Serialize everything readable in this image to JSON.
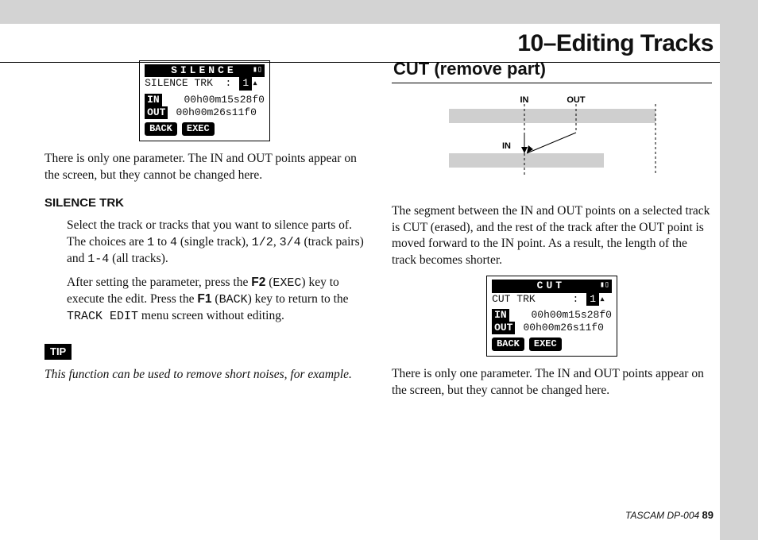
{
  "chapter_title": "10–Editing Tracks",
  "left": {
    "lcd": {
      "title": "SILENCE",
      "row_label": "SILENCE TRK",
      "row_value": "1",
      "in_label": "IN",
      "in_value": "00h00m15s28f0",
      "out_label": "OUT",
      "out_value": "00h00m26s11f0",
      "btn_back": "BACK",
      "btn_exec": "EXEC"
    },
    "p1": "There is only one parameter. The IN and OUT points appear on the screen, but they cannot be changed here.",
    "def_head": "SILENCE TRK",
    "def_p1_a": "Select the track or tracks that you want to silence parts of. The choices are ",
    "def_p1_b": " to ",
    "def_p1_c": " (single track), ",
    "def_p1_d": ", ",
    "def_p1_e": " (track pairs) and ",
    "def_p1_f": " (all tracks).",
    "mono": {
      "one": "1",
      "four": "4",
      "half12": "1/2",
      "half34": "3/4",
      "all": "1-4"
    },
    "def_p2_a": "After setting the parameter, press the ",
    "def_p2_b": " key to execute the edit. Press the ",
    "def_p2_c": " key to return to the ",
    "def_p2_d": " menu screen without editing.",
    "key_f2": "F2",
    "key_f2m": "EXEC",
    "key_f1": "F1",
    "key_f1m": "BACK",
    "menu": "TRACK EDIT",
    "tip_label": "TIP",
    "tip_text": "This function can be used to remove short noises, for example."
  },
  "right": {
    "section": "CUT (remove part)",
    "diagram": {
      "in": "IN",
      "out": "OUT"
    },
    "p1": "The segment between the IN and OUT points on a selected track is CUT (erased), and the rest of the track after the OUT point is moved forward to the IN point. As a result, the length of the track becomes shorter.",
    "lcd": {
      "title": "CUT",
      "row_label": "CUT TRK",
      "row_value": "1",
      "in_label": "IN",
      "in_value": "00h00m15s28f0",
      "out_label": "OUT",
      "out_value": "00h00m26s11f0",
      "btn_back": "BACK",
      "btn_exec": "EXEC"
    },
    "p2": "There is only one parameter. The IN and OUT points appear on the screen, but they cannot be changed here."
  },
  "footer": {
    "product": "TASCAM  DP-004",
    "page": "89"
  }
}
